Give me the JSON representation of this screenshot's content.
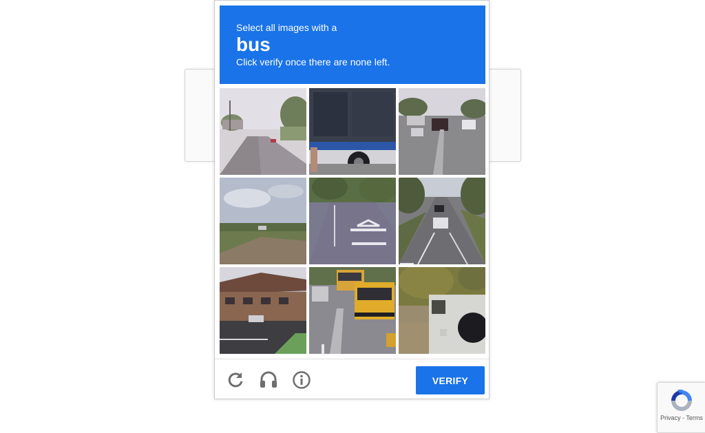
{
  "challenge": {
    "instruction_line1": "Select all images with a",
    "keyword": "bus",
    "instruction_line3": "Click verify once there are none left.",
    "header_color": "#1a73e8"
  },
  "tiles": [
    {
      "row": 1,
      "col": 1,
      "scene": "road-with-trees"
    },
    {
      "row": 1,
      "col": 2,
      "scene": "bus-side"
    },
    {
      "row": 1,
      "col": 3,
      "scene": "street-with-cars"
    },
    {
      "row": 2,
      "col": 1,
      "scene": "field-and-sky"
    },
    {
      "row": 2,
      "col": 2,
      "scene": "road-markings"
    },
    {
      "row": 2,
      "col": 3,
      "scene": "highway-with-cars"
    },
    {
      "row": 3,
      "col": 1,
      "scene": "building-parking-lot"
    },
    {
      "row": 3,
      "col": 2,
      "scene": "school-buses"
    },
    {
      "row": 3,
      "col": 3,
      "scene": "vehicle-rear"
    }
  ],
  "footer": {
    "reload_icon": "reload-icon",
    "audio_icon": "headphones-icon",
    "info_icon": "info-icon",
    "verify_label": "VERIFY",
    "verify_color": "#1a73e8"
  },
  "badge": {
    "privacy": "Privacy",
    "separator": " - ",
    "terms": "Terms"
  }
}
